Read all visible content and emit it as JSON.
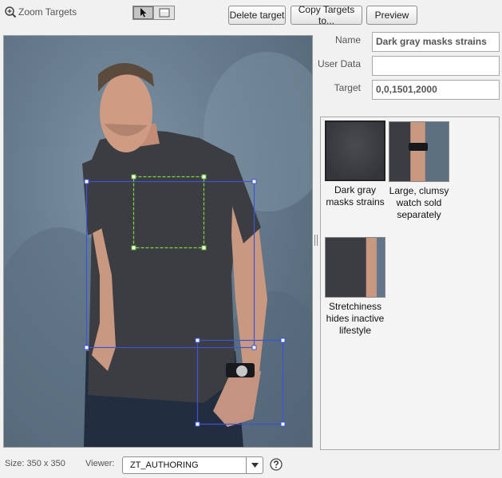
{
  "header": {
    "title": "Zoom Targets",
    "tools": [
      {
        "icon": "pointer-arrow-icon",
        "active": true
      },
      {
        "icon": "rectangle-select-icon",
        "active": false
      }
    ],
    "buttons": {
      "delete": "Delete target",
      "copy": "Copy Targets to...",
      "preview": "Preview"
    }
  },
  "form": {
    "name_label": "Name",
    "name_value": "Dark gray masks strains",
    "user_data_label": "User Data",
    "user_data_value": "",
    "target_label": "Target",
    "target_value": "0,0,1501,2000"
  },
  "targets": [
    {
      "caption": "Dark gray masks strains",
      "selected": true
    },
    {
      "caption": "Large, clumsy watch sold separately",
      "selected": false
    },
    {
      "caption": "Stretchiness hides inactive lifestyle",
      "selected": false
    }
  ],
  "footer": {
    "size": "Size: 350 x 350",
    "viewer_label": "Viewer:",
    "viewer_value": "ZT_AUTHORING"
  },
  "colors": {
    "target_box": "#3c55d8",
    "selected_box": "#7ed63a",
    "backdrop": "#667b8d",
    "shirt": "#3c3d42",
    "jeans": "#232d40",
    "skin": "#c99880"
  }
}
